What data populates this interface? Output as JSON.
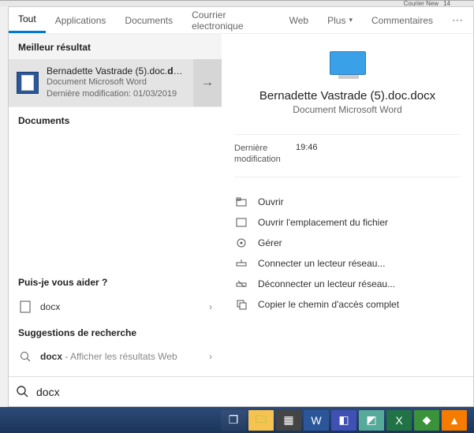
{
  "top_strip": {
    "label": "Courier New",
    "size": "14"
  },
  "tabs": {
    "all": "Tout",
    "apps": "Applications",
    "docs": "Documents",
    "mail": "Courrier electronique",
    "web": "Web",
    "more": "Plus",
    "feedback": "Commentaires"
  },
  "left": {
    "best_header": "Meilleur résultat",
    "best": {
      "title_plain": "Bernadette Vastrade (5).doc.",
      "title_bold": "docx",
      "type": "Document Microsoft Word",
      "modified": "Dernière modification: 01/03/2019"
    },
    "docs_header": "Documents",
    "assist_header": "Puis-je vous aider ?",
    "assist_item": "docx",
    "sugg_header": "Suggestions de recherche",
    "sugg_item": "docx",
    "sugg_suffix": " - Afficher les résultats Web"
  },
  "preview": {
    "title": "Bernadette Vastrade (5).doc.docx",
    "type": "Document Microsoft Word",
    "meta_label": "Dernière modification",
    "meta_value": "19:46",
    "actions": {
      "open": "Ouvrir",
      "open_loc": "Ouvrir l'emplacement du fichier",
      "manage": "Gérer",
      "map_drive": "Connecter un lecteur réseau...",
      "unmap_drive": "Déconnecter un lecteur réseau...",
      "copy_path": "Copier le chemin d'accès complet"
    }
  },
  "search": {
    "value": "docx"
  }
}
